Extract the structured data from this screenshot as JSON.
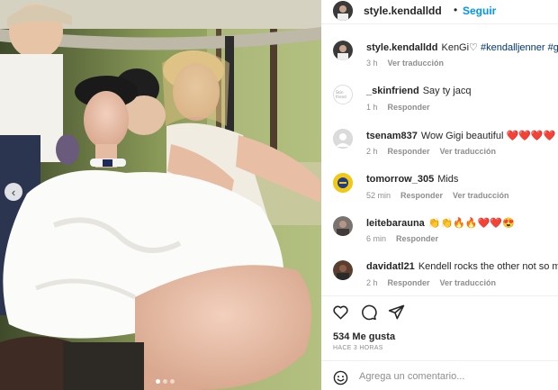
{
  "post": {
    "author": "style.kendalldd",
    "separator": "•",
    "follow_label": "Seguir",
    "caption_text": "KenGi♡",
    "caption_hashtags": "#kendalljenner #gigihadid",
    "caption_time": "3 h",
    "caption_translate": "Ver traducción"
  },
  "comments": [
    {
      "user": "_skinfriend",
      "text": "Say ty jacq",
      "time": "1 h",
      "actions": [
        "Responder"
      ]
    },
    {
      "user": "tsenam837",
      "text": "Wow Gigi beautiful",
      "text_emoji": "❤️❤️❤️❤️",
      "time": "2 h",
      "actions": [
        "Responder",
        "Ver traducción"
      ]
    },
    {
      "user": "tomorrow_305",
      "text": "Mids",
      "time": "52 min",
      "actions": [
        "Responder",
        "Ver traducción"
      ]
    },
    {
      "user": "leitebarauna",
      "text": "👏👏🔥🔥❤️❤️😍",
      "time": "6 min",
      "actions": [
        "Responder"
      ]
    },
    {
      "user": "davidatl21",
      "text": "Kendell rocks the other not so much",
      "time": "2 h",
      "actions": [
        "Responder",
        "Ver traducción"
      ]
    }
  ],
  "engagement": {
    "likes": "534 Me gusta",
    "posted_ago": "HACE 3 HORAS"
  },
  "composer": {
    "placeholder": "Agrega un comentario..."
  },
  "icons": {
    "like": "heart-icon",
    "comment": "comment-bubble-icon",
    "share": "paper-plane-icon",
    "emoji": "smiley-icon",
    "prev": "chevron-left-icon"
  },
  "colors": {
    "follow_blue": "#0095f6",
    "hashtag": "#00376b",
    "muted": "#8e8e8e"
  }
}
